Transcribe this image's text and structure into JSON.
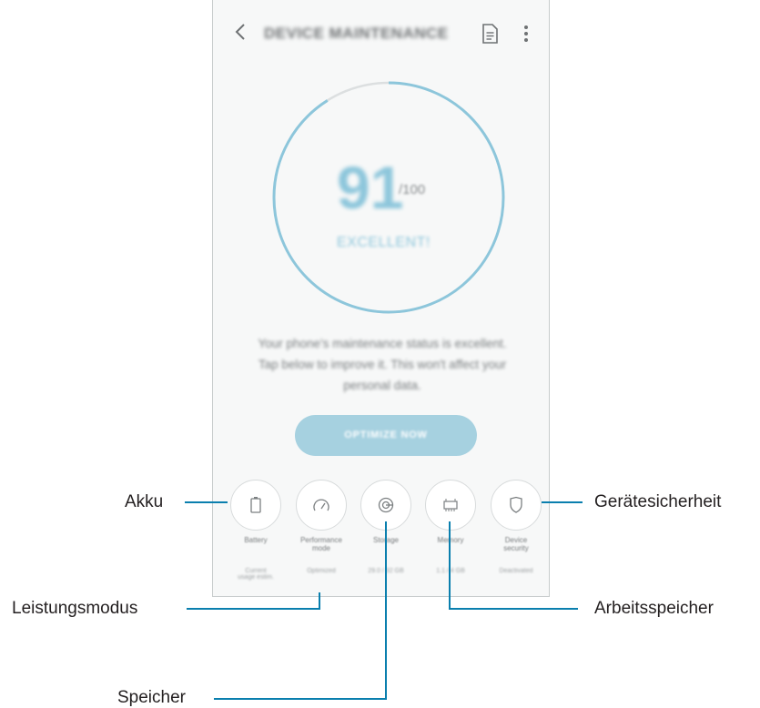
{
  "app": {
    "title": "DEVICE MAINTENANCE",
    "back_icon": "back-arrow-icon",
    "report_icon": "document-icon",
    "more_icon": "more-vert-icon"
  },
  "score": {
    "value": "91",
    "out_of": "/100",
    "fraction": 0.91,
    "status": "EXCELLENT!",
    "ring_color": "#8dc6db"
  },
  "description": {
    "line1": "Your phone's maintenance status is excellent.",
    "line2": "Tap below to improve it. This won't affect your",
    "line3": "personal data."
  },
  "optimize_button": {
    "label": "OPTIMIZE NOW",
    "color": "#a6d1e0"
  },
  "features": [
    {
      "icon": "battery-icon",
      "label_line1": "Battery",
      "label_line2": "",
      "sub_line1": "Current",
      "sub_line2": "usage estim."
    },
    {
      "icon": "performance-gauge-icon",
      "label_line1": "Performance",
      "label_line2": "mode",
      "sub_line1": "Optimized",
      "sub_line2": ""
    },
    {
      "icon": "storage-disc-icon",
      "label_line1": "Storage",
      "label_line2": "",
      "sub_line1": "29.0 / 32 GB",
      "sub_line2": ""
    },
    {
      "icon": "memory-chip-icon",
      "label_line1": "Memory",
      "label_line2": "",
      "sub_line1": "1.1 / 4 GB",
      "sub_line2": ""
    },
    {
      "icon": "shield-icon",
      "label_line1": "Device",
      "label_line2": "security",
      "sub_line1": "Deactivated",
      "sub_line2": ""
    }
  ],
  "callouts": {
    "akku": "Akku",
    "leistungsmodus": "Leistungsmodus",
    "speicher": "Speicher",
    "geraetesicherheit": "Gerätesicherheit",
    "arbeitsspeicher": "Arbeitsspeicher",
    "line_color": "#0a7fae"
  }
}
